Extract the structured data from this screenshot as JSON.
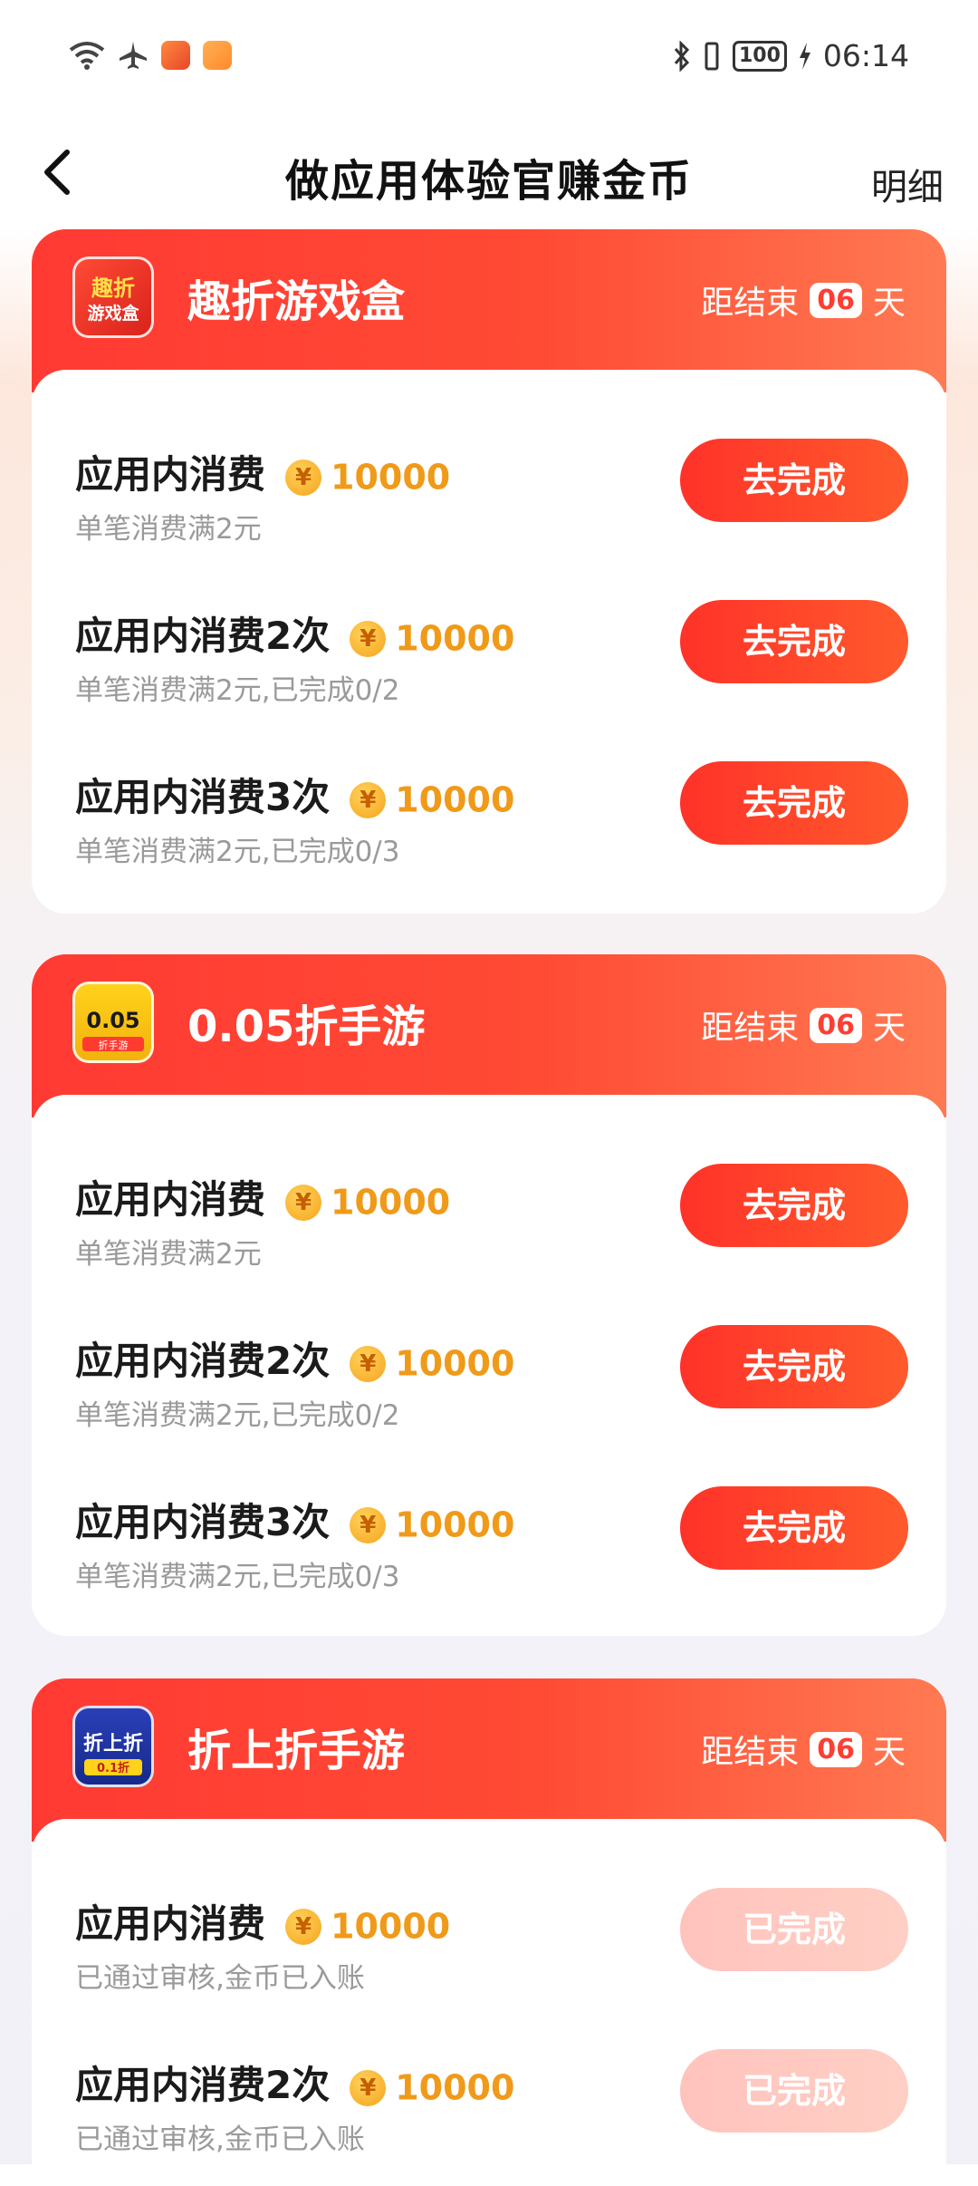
{
  "status_bar": {
    "time": "06:14",
    "battery": "100",
    "icons": [
      "wifi-icon",
      "airplane-icon",
      "app-notification-icon",
      "app-notification-icon-2",
      "bluetooth-icon",
      "vibrate-icon",
      "battery-icon",
      "charging-icon"
    ]
  },
  "nav": {
    "title": "做应用体验官赚金币",
    "right_label": "明细"
  },
  "cards": [
    {
      "name": "趣折游戏盒",
      "logo_text": "趣折 游戏盒",
      "countdown_label": "距结束",
      "countdown_value": "06",
      "countdown_unit": "天",
      "tasks": [
        {
          "title": "应用内消费",
          "coins": "10000",
          "sub": "单笔消费满2元",
          "button": "去完成",
          "done": false
        },
        {
          "title": "应用内消费2次",
          "coins": "10000",
          "sub": "单笔消费满2元,已完成0/2",
          "button": "去完成",
          "done": false
        },
        {
          "title": "应用内消费3次",
          "coins": "10000",
          "sub": "单笔消费满2元,已完成0/3",
          "button": "去完成",
          "done": false
        }
      ]
    },
    {
      "name": "0.05折手游",
      "logo_text": "0.05折",
      "countdown_label": "距结束",
      "countdown_value": "06",
      "countdown_unit": "天",
      "tasks": [
        {
          "title": "应用内消费",
          "coins": "10000",
          "sub": "单笔消费满2元",
          "button": "去完成",
          "done": false
        },
        {
          "title": "应用内消费2次",
          "coins": "10000",
          "sub": "单笔消费满2元,已完成0/2",
          "button": "去完成",
          "done": false
        },
        {
          "title": "应用内消费3次",
          "coins": "10000",
          "sub": "单笔消费满2元,已完成0/3",
          "button": "去完成",
          "done": false
        }
      ]
    },
    {
      "name": "折上折手游",
      "logo_text": "折上折",
      "countdown_label": "距结束",
      "countdown_value": "06",
      "countdown_unit": "天",
      "tasks": [
        {
          "title": "应用内消费",
          "coins": "10000",
          "sub": "已通过审核,金币已入账",
          "button": "已完成",
          "done": true
        },
        {
          "title": "应用内消费2次",
          "coins": "10000",
          "sub": "已通过审核,金币已入账",
          "button": "已完成",
          "done": true
        }
      ]
    }
  ],
  "colors": {
    "header_start": "#ff3a33",
    "header_end": "#ff7a52",
    "coin_text": "#f09a19",
    "button_active": "#ff3229",
    "button_done": "#ffc3bd"
  }
}
